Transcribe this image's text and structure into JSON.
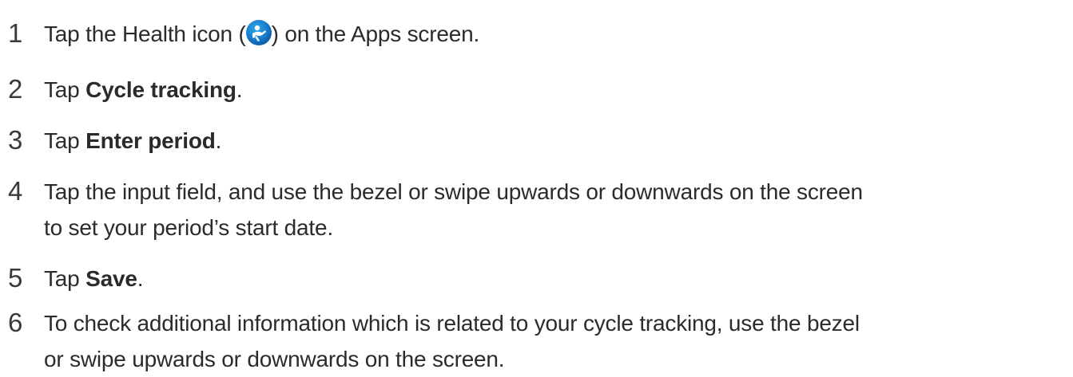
{
  "steps": [
    {
      "number": "1",
      "before": "Tap the Health icon (",
      "icon": "health-app-icon",
      "after": ") on the Apps screen."
    },
    {
      "number": "2",
      "before": "Tap ",
      "bold": "Cycle tracking",
      "after": "."
    },
    {
      "number": "3",
      "before": "Tap ",
      "bold": "Enter period",
      "after": "."
    },
    {
      "number": "4",
      "line1": "Tap the input field, and use the bezel or swipe upwards or downwards on the screen",
      "line2": "to set your period’s start date."
    },
    {
      "number": "5",
      "before": "Tap ",
      "bold": "Save",
      "after": "."
    },
    {
      "number": "6",
      "line1": "To check additional information which is related to your cycle tracking, use the bezel",
      "line2": "or swipe upwards or downwards on the screen."
    }
  ]
}
